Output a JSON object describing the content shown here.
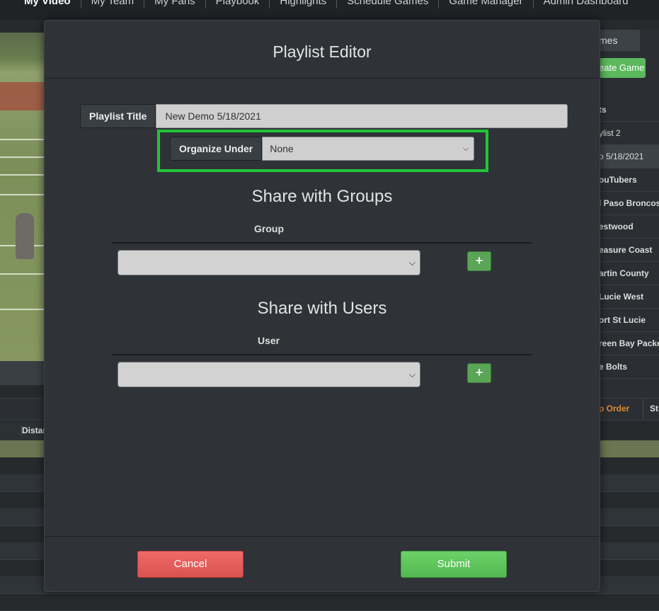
{
  "nav": {
    "items": [
      "My Video",
      "My Team",
      "My Fans",
      "Playbook",
      "Highlights",
      "Schedule Games",
      "Game Manager",
      "Admin Dashboard"
    ]
  },
  "background": {
    "right_tab": "mes",
    "create_game": "eate Game",
    "list_header": "ts",
    "list_items": [
      "ylist 2",
      "o 5/18/2021",
      "ouTubers",
      "l Paso Broncos",
      "estwood",
      "easure Coast",
      "artin County",
      "Lucie West",
      "ort St Lucie",
      "reen Bay Packe",
      "e Bolts"
    ],
    "tab_order": "p Order",
    "tab_st": "St",
    "table_col": "Distan"
  },
  "modal": {
    "title": "Playlist Editor",
    "playlist_title_label": "Playlist Title",
    "playlist_title_value": "New Demo 5/18/2021",
    "organize_label": "Organize Under",
    "organize_value": "None",
    "groups_title": "Share with Groups",
    "group_col": "Group",
    "users_title": "Share with Users",
    "user_col": "User",
    "plus": "+",
    "cancel": "Cancel",
    "submit": "Submit"
  },
  "colors": {
    "highlight": "#22c43a",
    "cancel": "#d9534f",
    "submit": "#5cb85c"
  }
}
